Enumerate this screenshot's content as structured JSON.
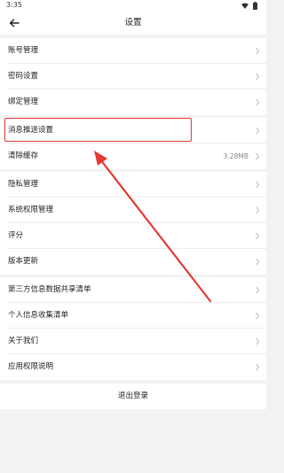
{
  "status": {
    "time": "3:35"
  },
  "header": {
    "title": "设置"
  },
  "group1": [
    {
      "label": "账号管理"
    },
    {
      "label": "密码设置"
    },
    {
      "label": "绑定管理"
    }
  ],
  "group2": [
    {
      "label": "消息推送设置"
    },
    {
      "label": "清除缓存",
      "value": "3.28MB"
    }
  ],
  "group3": [
    {
      "label": "隐私管理"
    },
    {
      "label": "系统权限管理"
    },
    {
      "label": "评分"
    },
    {
      "label": "版本更新"
    }
  ],
  "group4": [
    {
      "label": "第三方信息数据共享清单"
    },
    {
      "label": "个人信息收集清单"
    },
    {
      "label": "关于我们"
    },
    {
      "label": "应用权限说明"
    }
  ],
  "logout": {
    "label": "退出登录"
  },
  "annotation": {
    "color": "#e53935"
  },
  "icons": [
    "back-arrow-icon",
    "chevron-right-icon",
    "wifi-icon",
    "battery-icon"
  ]
}
